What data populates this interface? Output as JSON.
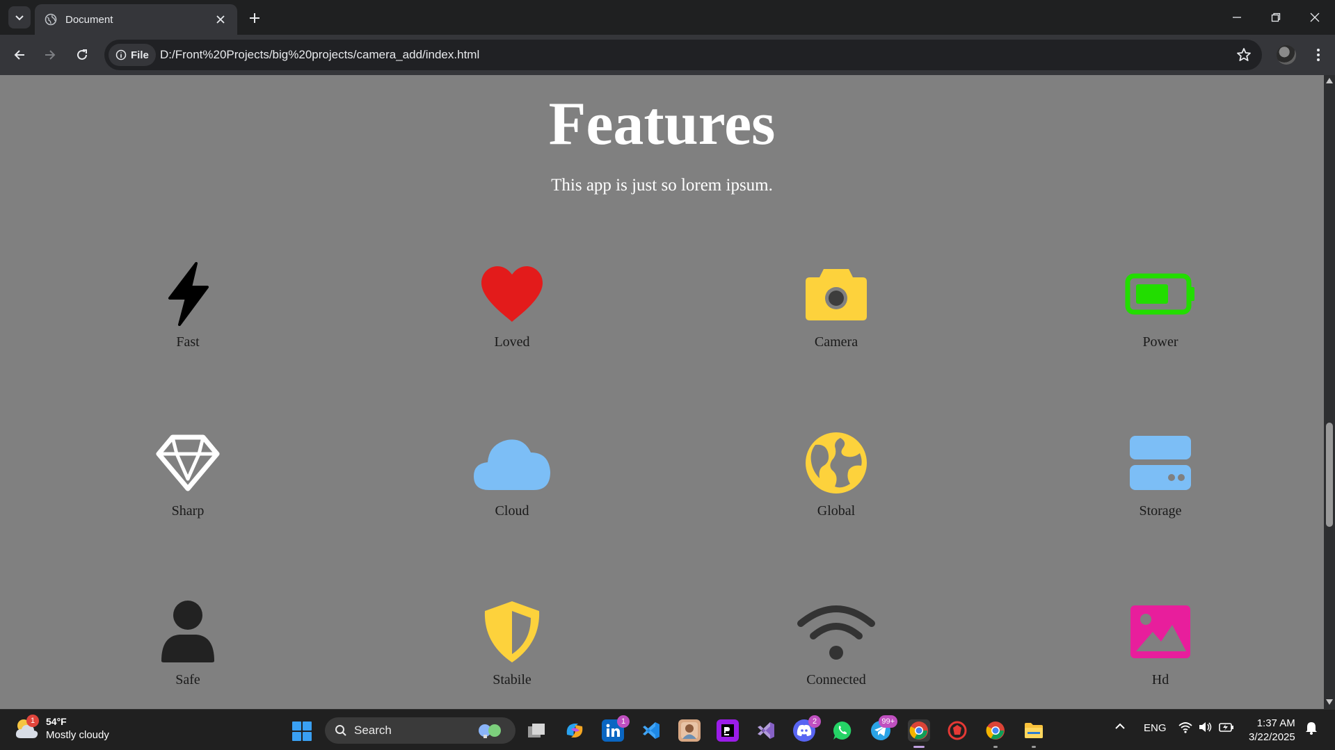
{
  "browser": {
    "tab_title": "Document",
    "site_chip": "File",
    "url": "D:/Front%20Projects/big%20projects/camera_add/index.html"
  },
  "page": {
    "title": "Features",
    "subtitle": "This app is just so lorem ipsum.",
    "features": [
      {
        "label": "Fast",
        "icon": "lightning-bolt-icon",
        "color": "#000000"
      },
      {
        "label": "Loved",
        "icon": "heart-icon",
        "color": "#e31b1b"
      },
      {
        "label": "Camera",
        "icon": "camera-icon",
        "color": "#fdd23c"
      },
      {
        "label": "Power",
        "icon": "battery-icon",
        "color": "#22dd00"
      },
      {
        "label": "Sharp",
        "icon": "diamond-icon",
        "color": "#ffffff"
      },
      {
        "label": "Cloud",
        "icon": "cloud-icon",
        "color": "#7cbef6"
      },
      {
        "label": "Global",
        "icon": "globe-icon",
        "color": "#fdd23c"
      },
      {
        "label": "Storage",
        "icon": "storage-icon",
        "color": "#7cbef6"
      },
      {
        "label": "Safe",
        "icon": "user-icon",
        "color": "#222222"
      },
      {
        "label": "Stabile",
        "icon": "shield-icon",
        "color": "#fdd23c"
      },
      {
        "label": "Connected",
        "icon": "wifi-icon",
        "color": "#333333"
      },
      {
        "label": "Hd",
        "icon": "image-icon",
        "color": "#e81e9c"
      }
    ]
  },
  "taskbar": {
    "weather_temp": "54°F",
    "weather_condition": "Mostly cloudy",
    "weather_badge": "1",
    "search_label": "Search",
    "linkedin_badge": "1",
    "discord_badge": "2",
    "telegram_badge": "99+",
    "language": "ENG",
    "time": "1:37 AM",
    "date": "3/22/2025"
  }
}
